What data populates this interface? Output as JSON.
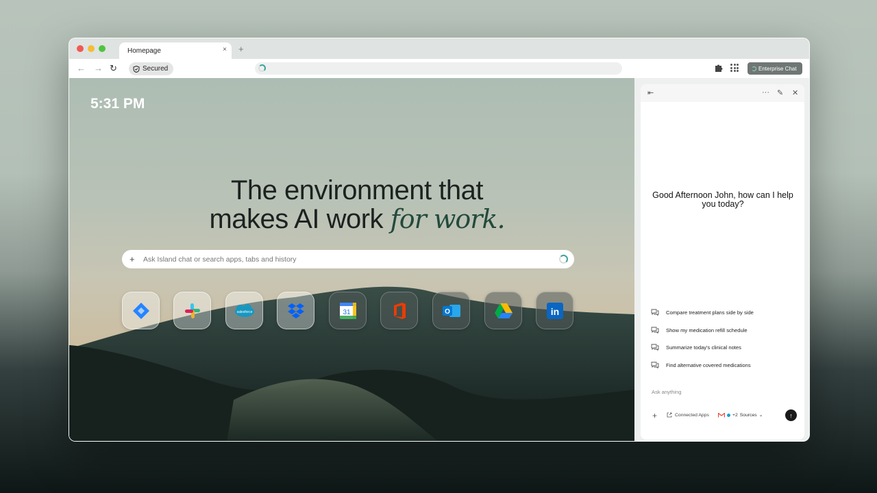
{
  "browser": {
    "tab_title": "Homepage",
    "tab_close": "×",
    "new_tab": "+",
    "nav_back": "←",
    "nav_forward": "→",
    "nav_reload": "↻",
    "secured_label": "Secured",
    "address_value": "",
    "enterprise_button": "Enterprise Chat"
  },
  "home": {
    "clock": "5:31 PM",
    "headline_line1": "The environment that",
    "headline_line2": "makes AI work ",
    "headline_italic": "for work.",
    "search_plus": "+",
    "search_placeholder": "Ask Island chat or search apps, tabs and history",
    "apps": [
      {
        "name": "jira-icon",
        "label": ""
      },
      {
        "name": "slack-icon",
        "label": ""
      },
      {
        "name": "salesforce-icon",
        "label": "salesforce"
      },
      {
        "name": "dropbox-icon",
        "label": ""
      },
      {
        "name": "google-calendar-icon",
        "label": "31"
      },
      {
        "name": "office-icon",
        "label": ""
      },
      {
        "name": "outlook-icon",
        "label": "O"
      },
      {
        "name": "google-drive-icon",
        "label": ""
      },
      {
        "name": "linkedin-icon",
        "label": "in"
      }
    ]
  },
  "chat": {
    "collapse": "⇤",
    "more": "···",
    "edit": "✎",
    "close": "✕",
    "greeting": "Good Afternoon John, how can I help you today?",
    "suggestions": [
      "Compare treatment plans side by side",
      "Show my medication refill schedule",
      "Summarize today's clinical notes",
      "Find alternative covered medications"
    ],
    "ask_placeholder": "Ask anything",
    "add": "+",
    "connected_apps": "Connected Apps",
    "sources_count": "+2",
    "sources_label": "Sources",
    "sources_chevron": "⌄",
    "send": "↑"
  },
  "colors": {
    "accent_teal": "#3aa39a",
    "enterprise_bg": "#6f7775",
    "headline_italic": "#234a3c"
  }
}
